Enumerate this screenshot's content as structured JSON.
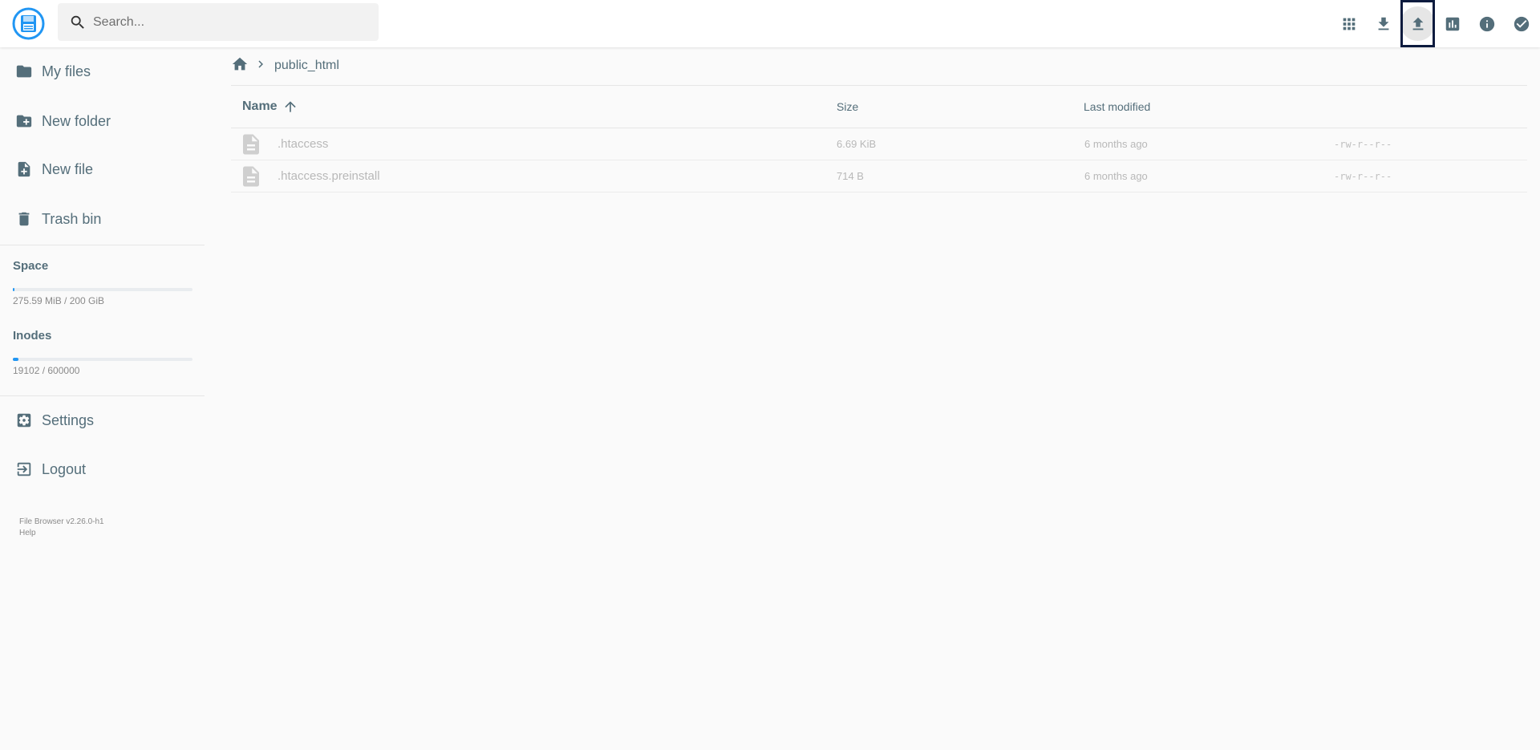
{
  "header": {
    "search_placeholder": "Search...",
    "actions": [
      {
        "icon": "grid-view-icon",
        "name": "view-toggle-button"
      },
      {
        "icon": "download-icon",
        "name": "download-button"
      },
      {
        "icon": "upload-icon",
        "name": "upload-button"
      },
      {
        "icon": "bar-chart-icon",
        "name": "disk-usage-button"
      },
      {
        "icon": "info-icon",
        "name": "info-button"
      },
      {
        "icon": "check-circle-icon",
        "name": "select-button"
      }
    ]
  },
  "sidebar": {
    "items": [
      {
        "label": "My files",
        "icon": "folder-icon"
      },
      {
        "label": "New folder",
        "icon": "create-new-folder-icon"
      },
      {
        "label": "New file",
        "icon": "note-add-icon"
      },
      {
        "label": "Trash bin",
        "icon": "trash-icon"
      }
    ],
    "usage": {
      "space_title": "Space",
      "space_text": "275.59 MiB / 200 GiB",
      "space_fraction": 0.0013,
      "inodes_title": "Inodes",
      "inodes_text": "19102 / 600000",
      "inodes_fraction": 0.0318
    },
    "bottom_items": [
      {
        "label": "Settings",
        "icon": "settings-icon"
      },
      {
        "label": "Logout",
        "icon": "logout-icon"
      }
    ],
    "credits": {
      "version": "File Browser v2.26.0-h1",
      "help": "Help"
    }
  },
  "breadcrumbs": {
    "current": "public_html"
  },
  "table": {
    "headers": {
      "name": "Name",
      "size": "Size",
      "modified": "Last modified"
    },
    "rows": [
      {
        "name": ".htaccess",
        "size": "6.69 KiB",
        "modified": "6 months ago",
        "perm": "-rw-r--r--"
      },
      {
        "name": ".htaccess.preinstall",
        "size": "714 B",
        "modified": "6 months ago",
        "perm": "-rw-r--r--"
      }
    ]
  },
  "colors": {
    "accent": "#2196f3",
    "text": "#546e7a",
    "focus_outline": "#0d1b3e"
  }
}
